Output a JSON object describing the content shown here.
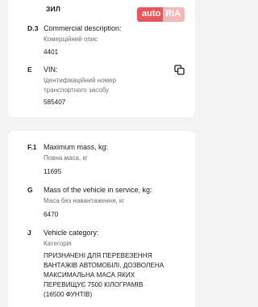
{
  "top_section": {
    "prev_value": "ЗИЛ",
    "fields": [
      {
        "code": "D.3",
        "title": "Commercial description:",
        "subtitle": "Комерційний опис",
        "value": "4401"
      },
      {
        "code": "E",
        "title": "VIN:",
        "subtitle_line1": "Ідентифікаційний номер",
        "subtitle_line2": "транспортного засобу",
        "value": "585407"
      }
    ]
  },
  "bottom_section": {
    "fields": [
      {
        "code": "F.1",
        "title": "Maximum mass, kg:",
        "subtitle": "Повна маса, кг",
        "value": "11695"
      },
      {
        "code": "G",
        "title": "Mass of the vehicle in service, kg:",
        "subtitle": "Маса без навантаження, кг",
        "value": "6470"
      },
      {
        "code": "J",
        "title": "Vehicle category:",
        "subtitle": "Категорія",
        "value_lines": [
          "ПРИЗНАЧЕНІ ДЛЯ ПЕРЕВЕЗЕННЯ",
          "ВАНТАЖІВ АВТОМОБІЛІ, ДОЗВОЛЕНА",
          "МАКСИМАЛЬНА МАСА ЯКИХ",
          "ПЕРЕВИЩУЄ 7500 КІЛОГРАМІВ",
          "(16500 ФУНТІВ)"
        ]
      }
    ]
  },
  "watermark": {
    "left": "auto",
    "right": "RIA",
    "colors": {
      "left": "#e64c4c",
      "right": "#f3b2b2"
    }
  },
  "icons": {
    "vin_copy": "copy-icon"
  }
}
